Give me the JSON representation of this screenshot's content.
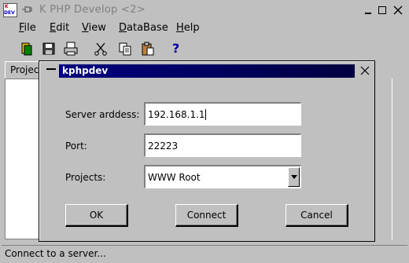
{
  "window": {
    "title": "K PHP Develop <2>",
    "app_icon_top": "K",
    "app_icon_bottom": "DEV"
  },
  "menu": [
    "File",
    "Edit",
    "View",
    "DataBase",
    "Help"
  ],
  "menu_access_keys": [
    "F",
    "E",
    "V",
    "D",
    "H"
  ],
  "toolbar": {
    "icons": [
      "new-icon",
      "save-icon",
      "print-icon",
      "cut-icon",
      "copy-icon",
      "paste-icon",
      "help-icon"
    ],
    "help_glyph": "?"
  },
  "main": {
    "tab_label": "Projec"
  },
  "status": {
    "text": "Connect to a server..."
  },
  "dialog": {
    "title": "kphpdev",
    "fields": {
      "server_label": "Server arddess:",
      "server_value": "192.168.1.1",
      "port_label": "Port:",
      "port_value": "22223",
      "projects_label": "Projects:",
      "projects_value": "WWW Root"
    },
    "buttons": {
      "ok": "OK",
      "connect": "Connect",
      "cancel": "Cancel"
    }
  },
  "colors": {
    "dialog_title_bg": "#000080",
    "window_bg": "#c0c0c0",
    "window_title_text": "#808080"
  }
}
